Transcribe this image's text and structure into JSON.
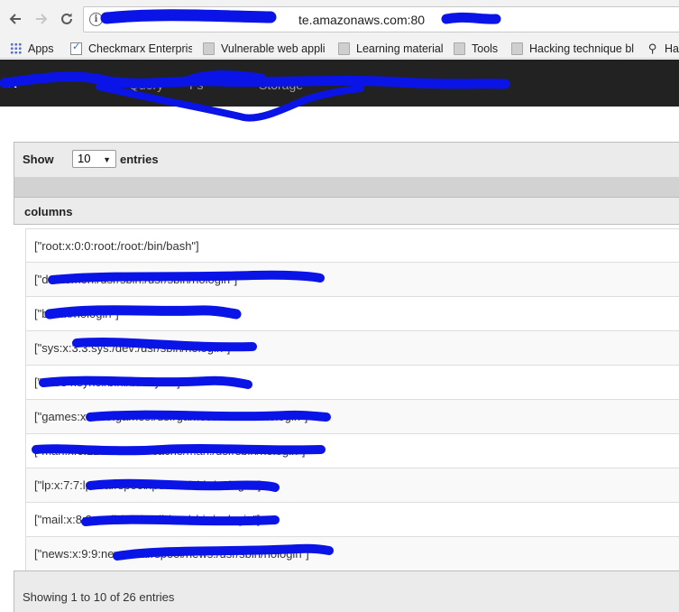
{
  "browser": {
    "url_visible": "te.amazonaws.com:80",
    "back_icon": "arrow-left-icon",
    "forward_icon": "arrow-right-icon",
    "reload_icon": "reload-icon",
    "info_icon": "info-icon"
  },
  "bookmarks": [
    {
      "label": "Apps",
      "icon": "apps-grid-icon"
    },
    {
      "label": "Checkmarx Enterprise",
      "icon": "checkmarx-icon"
    },
    {
      "label": "Vulnerable web appli",
      "icon": "folder-icon"
    },
    {
      "label": "Learning material",
      "icon": "folder-icon"
    },
    {
      "label": "Tools",
      "icon": "folder-icon"
    },
    {
      "label": "Hacking technique bl",
      "icon": "folder-icon"
    },
    {
      "label": "Ha",
      "icon": "pin-icon"
    }
  ],
  "app_nav": {
    "brand": "A",
    "items": [
      "Query",
      "Fs",
      "Storage"
    ]
  },
  "table": {
    "length_label": "Show",
    "length_value": "10",
    "length_suffix": "entries",
    "column_header": "columns",
    "rows": [
      "[\"root:x:0:0:root:/root:/bin/bash\"]",
      "[\"d                daemon:/usr/sbin:/usr/sbin/nologin\"]",
      "[\"b                        /bin/nologin\"]",
      "[\"sys:x:3:3:sys:/dev:/usr/sbin/nologin\"]",
      "[\"s                 :534:sync:/bin:/bin/sync\"]",
      "[\"games:x:5:60:games:/usr/games:/usr/sbin/nologin\"]",
      "[\"man:x:6:12:man:/var/cache/man:/usr/sbin/nologin\"]",
      "[\"lp:x:7:7:lp:/var/spool/lpd:/usr/sbin/nologin\"]",
      "[\"mail:x:8:8:mail:/var/mail:/usr/sbin/nologin\"]",
      "[\"news:x:9:9:news:/var/spool/news:/usr/sbin/nologin\"]"
    ],
    "info": "Showing 1 to 10 of 26 entries"
  }
}
